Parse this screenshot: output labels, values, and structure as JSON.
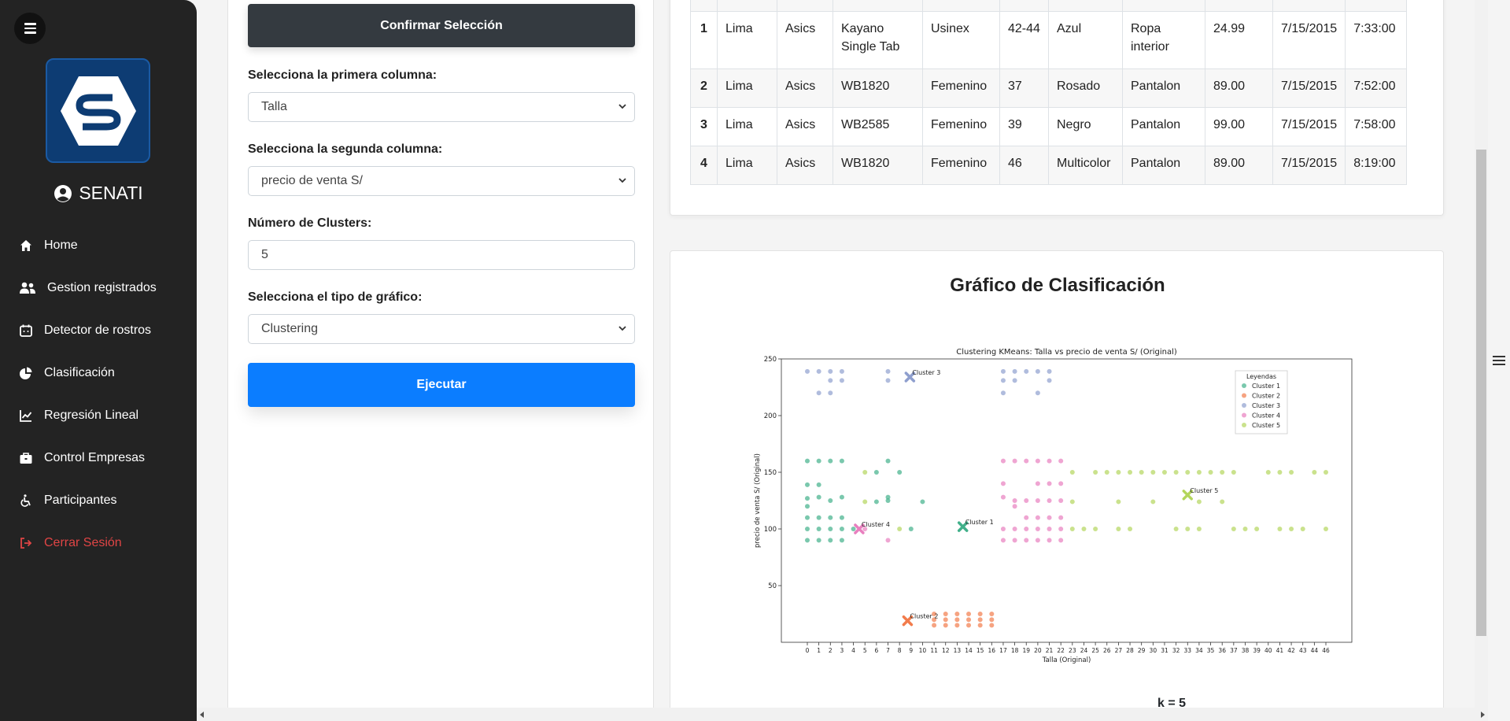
{
  "sidebar": {
    "brand": "SENATI",
    "items": [
      {
        "label": "Home",
        "icon": "home-icon"
      },
      {
        "label": "Gestion registrados",
        "icon": "users-icon"
      },
      {
        "label": "Detector de rostros",
        "icon": "calendar-face-icon"
      },
      {
        "label": "Clasificación",
        "icon": "pie-chart-icon"
      },
      {
        "label": "Regresión Lineal",
        "icon": "line-chart-icon"
      },
      {
        "label": "Control Empresas",
        "icon": "briefcase-icon"
      },
      {
        "label": "Participantes",
        "icon": "wheelchair-icon"
      },
      {
        "label": "Cerrar Sesión",
        "icon": "logout-icon"
      }
    ]
  },
  "form": {
    "confirm_label": "Confirmar Selección",
    "col1_label": "Selecciona la primera columna:",
    "col1_value": "Talla",
    "col2_label": "Selecciona la segunda columna:",
    "col2_value": "precio de venta S/",
    "clusters_label": "Número de Clusters:",
    "clusters_value": "5",
    "chart_type_label": "Selecciona el tipo de gráfico:",
    "chart_type_value": "Clustering",
    "execute_label": "Ejecutar"
  },
  "table": {
    "rows": [
      [
        "1",
        "Lima",
        "Asics",
        "Kayano Single Tab",
        "Usinex",
        "42-44",
        "Azul",
        "Ropa interior",
        "24.99",
        "7/15/2015",
        "7:33:00"
      ],
      [
        "2",
        "Lima",
        "Asics",
        "WB1820",
        "Femenino",
        "37",
        "Rosado",
        "Pantalon",
        "89.00",
        "7/15/2015",
        "7:52:00"
      ],
      [
        "3",
        "Lima",
        "Asics",
        "WB2585",
        "Femenino",
        "39",
        "Negro",
        "Pantalon",
        "99.00",
        "7/15/2015",
        "7:58:00"
      ],
      [
        "4",
        "Lima",
        "Asics",
        "WB1820",
        "Femenino",
        "46",
        "Multicolor",
        "Pantalon",
        "89.00",
        "7/15/2015",
        "8:19:00"
      ]
    ]
  },
  "chart_section": {
    "heading": "Gráfico de Clasificación",
    "k_text": "k = 5"
  },
  "chart_data": {
    "type": "scatter",
    "title": "Clustering KMeans: Talla vs precio de venta S/ (Original)",
    "xlabel": "Talla (Original)",
    "ylabel": "precio de venta S/ (Original)",
    "ylim": [
      0,
      250
    ],
    "yticks": [
      50,
      100,
      150,
      200,
      250
    ],
    "categories": [
      "0",
      "1",
      "2",
      "3",
      "4",
      "5",
      "6",
      "7",
      "8",
      "9",
      "10",
      "11",
      "12",
      "13",
      "14",
      "15",
      "16",
      "17",
      "18",
      "19",
      "20",
      "21",
      "22",
      "23",
      "24",
      "25",
      "26",
      "27",
      "28",
      "29",
      "30",
      "31",
      "32",
      "33",
      "34",
      "35",
      "36",
      "37",
      "38",
      "39",
      "40",
      "41",
      "42",
      "43",
      "44",
      "46"
    ],
    "legend_title": "Leyendas",
    "legend_position": "top-right",
    "series": [
      {
        "name": "Cluster 1",
        "color": "#41b08a",
        "points": [
          [
            0,
            90
          ],
          [
            0,
            100
          ],
          [
            0,
            110
          ],
          [
            0,
            120
          ],
          [
            0,
            127
          ],
          [
            0,
            139
          ],
          [
            0,
            160
          ],
          [
            1,
            90
          ],
          [
            1,
            100
          ],
          [
            1,
            110
          ],
          [
            1,
            128
          ],
          [
            1,
            139
          ],
          [
            1,
            160
          ],
          [
            2,
            90
          ],
          [
            2,
            100
          ],
          [
            2,
            110
          ],
          [
            2,
            125
          ],
          [
            2,
            160
          ],
          [
            3,
            90
          ],
          [
            3,
            100
          ],
          [
            3,
            110
          ],
          [
            3,
            128
          ],
          [
            3,
            160
          ],
          [
            4,
            100
          ],
          [
            6,
            124
          ],
          [
            6,
            150
          ],
          [
            7,
            125
          ],
          [
            7,
            128
          ],
          [
            7,
            160
          ],
          [
            8,
            150
          ],
          [
            9,
            100
          ],
          [
            10,
            124
          ]
        ],
        "centroid": [
          13.5,
          102
        ],
        "label": "Cluster 1"
      },
      {
        "name": "Cluster 2",
        "color": "#f27c4c",
        "points": [
          [
            11,
            15
          ],
          [
            11,
            20
          ],
          [
            11,
            25
          ],
          [
            12,
            15
          ],
          [
            12,
            20
          ],
          [
            12,
            25
          ],
          [
            13,
            15
          ],
          [
            13,
            20
          ],
          [
            13,
            25
          ],
          [
            14,
            15
          ],
          [
            14,
            20
          ],
          [
            14,
            25
          ],
          [
            15,
            15
          ],
          [
            15,
            20
          ],
          [
            15,
            25
          ],
          [
            16,
            15
          ],
          [
            16,
            20
          ],
          [
            16,
            25
          ]
        ],
        "centroid": [
          8.7,
          19
        ],
        "label": "Cluster 2"
      },
      {
        "name": "Cluster 3",
        "color": "#8f9fce",
        "points": [
          [
            0,
            239
          ],
          [
            1,
            220
          ],
          [
            1,
            239
          ],
          [
            2,
            220
          ],
          [
            2,
            231
          ],
          [
            2,
            239
          ],
          [
            3,
            231
          ],
          [
            3,
            239
          ],
          [
            7,
            231
          ],
          [
            7,
            239
          ],
          [
            17,
            220
          ],
          [
            17,
            231
          ],
          [
            17,
            239
          ],
          [
            18,
            231
          ],
          [
            18,
            239
          ],
          [
            19,
            239
          ],
          [
            20,
            220
          ],
          [
            20,
            239
          ],
          [
            21,
            231
          ],
          [
            21,
            239
          ]
        ],
        "centroid": [
          8.9,
          234
        ],
        "label": "Cluster 3"
      },
      {
        "name": "Cluster 4",
        "color": "#e87fbf",
        "points": [
          [
            5,
            100
          ],
          [
            7,
            90
          ],
          [
            17,
            90
          ],
          [
            17,
            100
          ],
          [
            17,
            128
          ],
          [
            17,
            140
          ],
          [
            17,
            160
          ],
          [
            18,
            90
          ],
          [
            18,
            100
          ],
          [
            18,
            120
          ],
          [
            18,
            125
          ],
          [
            18,
            160
          ],
          [
            19,
            90
          ],
          [
            19,
            100
          ],
          [
            19,
            110
          ],
          [
            19,
            125
          ],
          [
            19,
            160
          ],
          [
            20,
            90
          ],
          [
            20,
            100
          ],
          [
            20,
            110
          ],
          [
            20,
            125
          ],
          [
            20,
            140
          ],
          [
            20,
            160
          ],
          [
            21,
            90
          ],
          [
            21,
            100
          ],
          [
            21,
            110
          ],
          [
            21,
            125
          ],
          [
            21,
            140
          ],
          [
            21,
            160
          ],
          [
            22,
            90
          ],
          [
            22,
            100
          ],
          [
            22,
            110
          ],
          [
            22,
            125
          ],
          [
            22,
            140
          ],
          [
            22,
            160
          ]
        ],
        "centroid": [
          4.5,
          100
        ],
        "label": "Cluster 4"
      },
      {
        "name": "Cluster 5",
        "color": "#b3d65c",
        "points": [
          [
            5,
            124
          ],
          [
            5,
            150
          ],
          [
            8,
            100
          ],
          [
            23,
            100
          ],
          [
            23,
            124
          ],
          [
            23,
            150
          ],
          [
            24,
            100
          ],
          [
            25,
            100
          ],
          [
            25,
            150
          ],
          [
            26,
            150
          ],
          [
            27,
            100
          ],
          [
            27,
            124
          ],
          [
            27,
            150
          ],
          [
            28,
            100
          ],
          [
            28,
            150
          ],
          [
            29,
            150
          ],
          [
            30,
            124
          ],
          [
            30,
            150
          ],
          [
            31,
            150
          ],
          [
            32,
            100
          ],
          [
            32,
            150
          ],
          [
            33,
            100
          ],
          [
            33,
            150
          ],
          [
            34,
            100
          ],
          [
            34,
            124
          ],
          [
            34,
            150
          ],
          [
            35,
            150
          ],
          [
            36,
            124
          ],
          [
            36,
            150
          ],
          [
            37,
            100
          ],
          [
            37,
            150
          ],
          [
            38,
            100
          ],
          [
            39,
            100
          ],
          [
            40,
            150
          ],
          [
            41,
            100
          ],
          [
            41,
            150
          ],
          [
            42,
            100
          ],
          [
            42,
            150
          ],
          [
            43,
            100
          ],
          [
            44,
            150
          ],
          [
            46,
            100
          ],
          [
            46,
            150
          ]
        ],
        "centroid": [
          33,
          130
        ],
        "label": "Cluster 5"
      }
    ]
  }
}
